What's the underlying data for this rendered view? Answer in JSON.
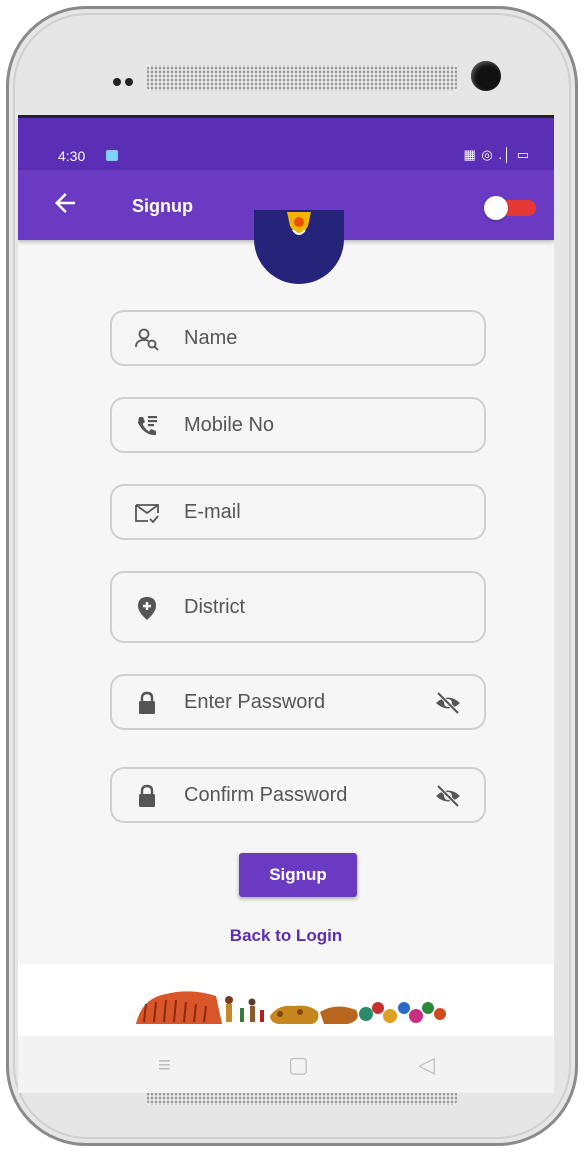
{
  "status": {
    "time": "4:30",
    "icons": "▦ ◎ .│ ▭"
  },
  "appbar": {
    "title": "Signup"
  },
  "form": {
    "name": {
      "placeholder": "Name"
    },
    "mobile": {
      "placeholder": "Mobile No"
    },
    "email": {
      "placeholder": "E-mail"
    },
    "district": {
      "placeholder": "District"
    },
    "password": {
      "placeholder": "Enter Password"
    },
    "confirm_password": {
      "placeholder": "Confirm Password"
    }
  },
  "actions": {
    "signup_label": "Signup",
    "back_to_login": "Back to Login"
  },
  "navbar": {
    "menu_glyph": "≡",
    "home_glyph": "▢",
    "back_glyph": "◁"
  },
  "colors": {
    "primary": "#6a3bc2",
    "statusbar": "#5b2fb5",
    "toggle_track": "#e53935",
    "logo_bg": "#25237a"
  },
  "icons": {
    "back": "arrow-left-icon",
    "toggle": "theme-toggle",
    "name": "person-search-icon",
    "mobile": "phone-contacts-icon",
    "email": "mail-check-icon",
    "district": "location-add-icon",
    "lock": "lock-icon",
    "eye": "visibility-off-icon"
  }
}
